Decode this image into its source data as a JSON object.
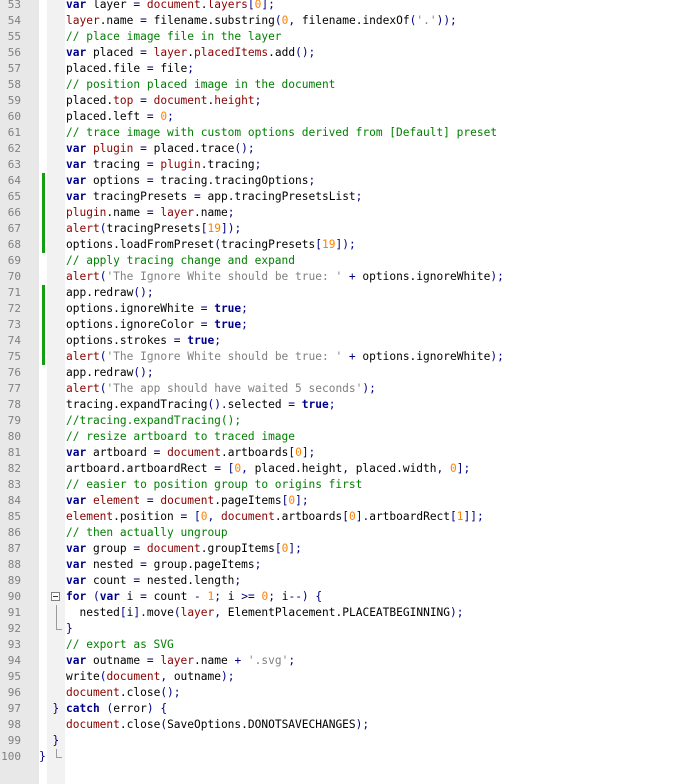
{
  "editor": {
    "lines": [
      {
        "n": "53",
        "segs": [
          [
            "kw",
            "var "
          ],
          [
            "pl",
            "layer "
          ],
          [
            "op",
            "= "
          ],
          [
            "pr",
            "document"
          ],
          [
            "pl",
            "."
          ],
          [
            "pr",
            "layers"
          ],
          [
            "op",
            "["
          ],
          [
            "nm",
            "0"
          ],
          [
            "op",
            "];"
          ]
        ]
      },
      {
        "n": "54",
        "segs": [
          [
            "pr",
            "layer"
          ],
          [
            "pl",
            ".name "
          ],
          [
            "op",
            "= "
          ],
          [
            "pl",
            "filename.substring"
          ],
          [
            "op",
            "("
          ],
          [
            "nm",
            "0"
          ],
          [
            "op",
            ", "
          ],
          [
            "pl",
            "filename.indexOf"
          ],
          [
            "op",
            "("
          ],
          [
            "st",
            "'.'"
          ],
          [
            "op",
            "));"
          ]
        ]
      },
      {
        "n": "55",
        "segs": [
          [
            "cm",
            "// place image file in the layer"
          ]
        ]
      },
      {
        "n": "56",
        "segs": [
          [
            "kw",
            "var "
          ],
          [
            "pl",
            "placed "
          ],
          [
            "op",
            "= "
          ],
          [
            "pr",
            "layer"
          ],
          [
            "pl",
            "."
          ],
          [
            "pr",
            "placedItems"
          ],
          [
            "pl",
            ".add"
          ],
          [
            "op",
            "();"
          ]
        ]
      },
      {
        "n": "57",
        "segs": [
          [
            "pl",
            "placed.file "
          ],
          [
            "op",
            "= "
          ],
          [
            "pl",
            "file"
          ],
          [
            "op",
            ";"
          ]
        ]
      },
      {
        "n": "58",
        "segs": [
          [
            "cm",
            "// position placed image in the document"
          ]
        ]
      },
      {
        "n": "59",
        "segs": [
          [
            "pl",
            "placed."
          ],
          [
            "pr",
            "top"
          ],
          [
            "op",
            " = "
          ],
          [
            "pr",
            "document"
          ],
          [
            "pl",
            "."
          ],
          [
            "pr",
            "height"
          ],
          [
            "op",
            ";"
          ]
        ]
      },
      {
        "n": "60",
        "segs": [
          [
            "pl",
            "placed.left "
          ],
          [
            "op",
            "= "
          ],
          [
            "nm",
            "0"
          ],
          [
            "op",
            ";"
          ]
        ]
      },
      {
        "n": "61",
        "segs": [
          [
            "cm",
            "// trace image with custom options derived from [Default] preset"
          ]
        ]
      },
      {
        "n": "62",
        "segs": [
          [
            "kw",
            "var "
          ],
          [
            "pr",
            "plugin"
          ],
          [
            "op",
            " = "
          ],
          [
            "pl",
            "placed.trace"
          ],
          [
            "op",
            "();"
          ]
        ]
      },
      {
        "n": "63",
        "segs": [
          [
            "kw",
            "var "
          ],
          [
            "pl",
            "tracing "
          ],
          [
            "op",
            "= "
          ],
          [
            "pr",
            "plugin"
          ],
          [
            "pl",
            ".tracing"
          ],
          [
            "op",
            ";"
          ]
        ]
      },
      {
        "n": "64",
        "mark": true,
        "segs": [
          [
            "kw",
            "var "
          ],
          [
            "pl",
            "options "
          ],
          [
            "op",
            "= "
          ],
          [
            "pl",
            "tracing.tracingOptions"
          ],
          [
            "op",
            ";"
          ]
        ]
      },
      {
        "n": "65",
        "mark": true,
        "segs": [
          [
            "kw",
            "var "
          ],
          [
            "pl",
            "tracingPresets "
          ],
          [
            "op",
            "= "
          ],
          [
            "pl",
            "app.tracingPresetsList"
          ],
          [
            "op",
            ";"
          ]
        ]
      },
      {
        "n": "66",
        "mark": true,
        "segs": [
          [
            "pr",
            "plugin"
          ],
          [
            "pl",
            ".name "
          ],
          [
            "op",
            "= "
          ],
          [
            "pr",
            "layer"
          ],
          [
            "pl",
            ".name"
          ],
          [
            "op",
            ";"
          ]
        ]
      },
      {
        "n": "67",
        "mark": true,
        "segs": [
          [
            "pr",
            "alert"
          ],
          [
            "op",
            "("
          ],
          [
            "pl",
            "tracingPresets"
          ],
          [
            "op",
            "["
          ],
          [
            "nm",
            "19"
          ],
          [
            "op",
            "]);"
          ]
        ]
      },
      {
        "n": "68",
        "mark": true,
        "segs": [
          [
            "pl",
            "options.loadFromPreset"
          ],
          [
            "op",
            "("
          ],
          [
            "pl",
            "tracingPresets"
          ],
          [
            "op",
            "["
          ],
          [
            "nm",
            "19"
          ],
          [
            "op",
            "]);"
          ]
        ]
      },
      {
        "n": "69",
        "segs": [
          [
            "cm",
            "// apply tracing change and expand"
          ]
        ]
      },
      {
        "n": "70",
        "segs": [
          [
            "pr",
            "alert"
          ],
          [
            "op",
            "("
          ],
          [
            "st",
            "'The Ignore White should be true: '"
          ],
          [
            "op",
            " + "
          ],
          [
            "pl",
            "options.ignoreWhite"
          ],
          [
            "op",
            ");"
          ]
        ]
      },
      {
        "n": "71",
        "mark": true,
        "segs": [
          [
            "pl",
            "app.redraw"
          ],
          [
            "op",
            "();"
          ]
        ]
      },
      {
        "n": "72",
        "mark": true,
        "segs": [
          [
            "pl",
            "options.ignoreWhite "
          ],
          [
            "op",
            "= "
          ],
          [
            "kw",
            "true"
          ],
          [
            "op",
            ";"
          ]
        ]
      },
      {
        "n": "73",
        "mark": true,
        "segs": [
          [
            "pl",
            "options.ignoreColor "
          ],
          [
            "op",
            "= "
          ],
          [
            "kw",
            "true"
          ],
          [
            "op",
            ";"
          ]
        ]
      },
      {
        "n": "74",
        "mark": true,
        "segs": [
          [
            "pl",
            "options.strokes "
          ],
          [
            "op",
            "= "
          ],
          [
            "kw",
            "true"
          ],
          [
            "op",
            ";"
          ]
        ]
      },
      {
        "n": "75",
        "mark": true,
        "segs": [
          [
            "pr",
            "alert"
          ],
          [
            "op",
            "("
          ],
          [
            "st",
            "'The Ignore White should be true: '"
          ],
          [
            "op",
            " + "
          ],
          [
            "pl",
            "options.ignoreWhite"
          ],
          [
            "op",
            ");"
          ]
        ]
      },
      {
        "n": "76",
        "segs": [
          [
            "pl",
            "app.redraw"
          ],
          [
            "op",
            "();"
          ]
        ]
      },
      {
        "n": "77",
        "segs": [
          [
            "pr",
            "alert"
          ],
          [
            "op",
            "("
          ],
          [
            "st",
            "'The app should have waited 5 seconds'"
          ],
          [
            "op",
            ");"
          ]
        ]
      },
      {
        "n": "78",
        "segs": [
          [
            "pl",
            "tracing.expandTracing"
          ],
          [
            "op",
            "()."
          ],
          [
            "pl",
            "selected "
          ],
          [
            "op",
            "= "
          ],
          [
            "kw",
            "true"
          ],
          [
            "op",
            ";"
          ]
        ]
      },
      {
        "n": "79",
        "segs": [
          [
            "cm",
            "//tracing.expandTracing();"
          ]
        ]
      },
      {
        "n": "80",
        "segs": [
          [
            "cm",
            "// resize artboard to traced image"
          ]
        ]
      },
      {
        "n": "81",
        "segs": [
          [
            "kw",
            "var "
          ],
          [
            "pl",
            "artboard "
          ],
          [
            "op",
            "= "
          ],
          [
            "pr",
            "document"
          ],
          [
            "pl",
            ".artboards"
          ],
          [
            "op",
            "["
          ],
          [
            "nm",
            "0"
          ],
          [
            "op",
            "];"
          ]
        ]
      },
      {
        "n": "82",
        "segs": [
          [
            "pl",
            "artboard.artboardRect "
          ],
          [
            "op",
            "= ["
          ],
          [
            "nm",
            "0"
          ],
          [
            "op",
            ", "
          ],
          [
            "pl",
            "placed.height"
          ],
          [
            "op",
            ", "
          ],
          [
            "pl",
            "placed.width"
          ],
          [
            "op",
            ", "
          ],
          [
            "nm",
            "0"
          ],
          [
            "op",
            "];"
          ]
        ]
      },
      {
        "n": "83",
        "segs": [
          [
            "cm",
            "// easier to position group to origins first"
          ]
        ]
      },
      {
        "n": "84",
        "segs": [
          [
            "kw",
            "var "
          ],
          [
            "pr",
            "element"
          ],
          [
            "op",
            " = "
          ],
          [
            "pr",
            "document"
          ],
          [
            "pl",
            ".pageItems"
          ],
          [
            "op",
            "["
          ],
          [
            "nm",
            "0"
          ],
          [
            "op",
            "];"
          ]
        ]
      },
      {
        "n": "85",
        "segs": [
          [
            "pr",
            "element"
          ],
          [
            "pl",
            ".position "
          ],
          [
            "op",
            "= ["
          ],
          [
            "nm",
            "0"
          ],
          [
            "op",
            ", "
          ],
          [
            "pr",
            "document"
          ],
          [
            "pl",
            ".artboards"
          ],
          [
            "op",
            "["
          ],
          [
            "nm",
            "0"
          ],
          [
            "op",
            "]."
          ],
          [
            "pl",
            "artboardRect"
          ],
          [
            "op",
            "["
          ],
          [
            "nm",
            "1"
          ],
          [
            "op",
            "]];"
          ]
        ]
      },
      {
        "n": "86",
        "segs": [
          [
            "cm",
            "// then actually ungroup"
          ]
        ]
      },
      {
        "n": "87",
        "segs": [
          [
            "kw",
            "var "
          ],
          [
            "pl",
            "group "
          ],
          [
            "op",
            "= "
          ],
          [
            "pr",
            "document"
          ],
          [
            "pl",
            ".groupItems"
          ],
          [
            "op",
            "["
          ],
          [
            "nm",
            "0"
          ],
          [
            "op",
            "];"
          ]
        ]
      },
      {
        "n": "88",
        "segs": [
          [
            "kw",
            "var "
          ],
          [
            "pl",
            "nested "
          ],
          [
            "op",
            "= "
          ],
          [
            "pl",
            "group.pageItems"
          ],
          [
            "op",
            ";"
          ]
        ]
      },
      {
        "n": "89",
        "segs": [
          [
            "kw",
            "var "
          ],
          [
            "pl",
            "count "
          ],
          [
            "op",
            "= "
          ],
          [
            "pl",
            "nested.length"
          ],
          [
            "op",
            ";"
          ]
        ]
      },
      {
        "n": "90",
        "fold": "box",
        "segs": [
          [
            "kw",
            "for "
          ],
          [
            "op",
            "("
          ],
          [
            "kw",
            "var "
          ],
          [
            "pl",
            "i "
          ],
          [
            "op",
            "= "
          ],
          [
            "pl",
            "count "
          ],
          [
            "op",
            "- "
          ],
          [
            "nm",
            "1"
          ],
          [
            "op",
            "; "
          ],
          [
            "pl",
            "i "
          ],
          [
            "op",
            ">= "
          ],
          [
            "nm",
            "0"
          ],
          [
            "op",
            "; "
          ],
          [
            "pl",
            "i"
          ],
          [
            "op",
            "--) {"
          ]
        ]
      },
      {
        "n": "91",
        "fold": "vl",
        "segs": [
          [
            "pl",
            "  nested"
          ],
          [
            "op",
            "["
          ],
          [
            "pl",
            "i"
          ],
          [
            "op",
            "]."
          ],
          [
            "pl",
            "move"
          ],
          [
            "op",
            "("
          ],
          [
            "pr",
            "layer"
          ],
          [
            "op",
            ", "
          ],
          [
            "pl",
            "ElementPlacement.PLACEATBEGINNING"
          ],
          [
            "op",
            ");"
          ]
        ]
      },
      {
        "n": "92",
        "fold": "end",
        "segs": [
          [
            "op",
            "}"
          ]
        ]
      },
      {
        "n": "93",
        "segs": [
          [
            "cm",
            "// export as SVG"
          ]
        ]
      },
      {
        "n": "94",
        "segs": [
          [
            "kw",
            "var "
          ],
          [
            "pl",
            "outname "
          ],
          [
            "op",
            "= "
          ],
          [
            "pr",
            "layer"
          ],
          [
            "pl",
            ".name "
          ],
          [
            "op",
            "+ "
          ],
          [
            "st",
            "'.svg'"
          ],
          [
            "op",
            ";"
          ]
        ]
      },
      {
        "n": "95",
        "segs": [
          [
            "pl",
            "write"
          ],
          [
            "op",
            "("
          ],
          [
            "pr",
            "document"
          ],
          [
            "op",
            ", "
          ],
          [
            "pl",
            "outname"
          ],
          [
            "op",
            ");"
          ]
        ]
      },
      {
        "n": "96",
        "segs": [
          [
            "pr",
            "document"
          ],
          [
            "pl",
            ".close"
          ],
          [
            "op",
            "();"
          ]
        ]
      },
      {
        "n": "97",
        "indent": -2,
        "segs": [
          [
            "op",
            "} "
          ],
          [
            "kw",
            "catch "
          ],
          [
            "op",
            "("
          ],
          [
            "pl",
            "error"
          ],
          [
            "op",
            ") {"
          ]
        ]
      },
      {
        "n": "98",
        "segs": [
          [
            "pr",
            "document"
          ],
          [
            "pl",
            ".close"
          ],
          [
            "op",
            "("
          ],
          [
            "pl",
            "SaveOptions.DONOTSAVECHANGES"
          ],
          [
            "op",
            ");"
          ]
        ]
      },
      {
        "n": "99",
        "indent": -2,
        "segs": [
          [
            "op",
            "}"
          ]
        ]
      },
      {
        "n": "100",
        "indent": -4,
        "fold": "end",
        "segs": [
          [
            "op",
            "}"
          ]
        ]
      }
    ]
  },
  "colors": {
    "keyword": "#00008b",
    "comment": "#008000",
    "string": "#808080",
    "number": "#ff8000",
    "property": "#8b0000",
    "change_marker": "#12a012",
    "gutter": "#e8e8e8"
  }
}
